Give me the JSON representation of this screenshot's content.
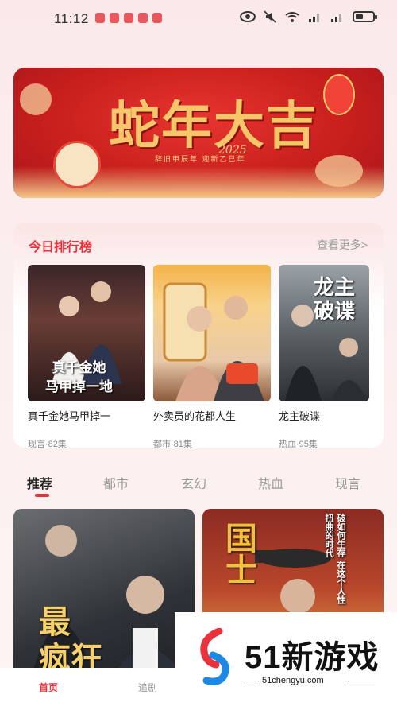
{
  "status_bar": {
    "time": "11:12"
  },
  "banner": {
    "title": "蛇年大吉",
    "year": "2025",
    "subtitle": "辞旧甲辰年 迎新乙巳年"
  },
  "ranking": {
    "title": "今日排行榜",
    "more_label": "查看更多>",
    "items": [
      {
        "name": "真千金她马甲掉一",
        "meta": "现言·82集",
        "cover_text": "真千金她\n马甲掉一地"
      },
      {
        "name": "外卖员的花都人生",
        "meta": "都市·81集",
        "cover_text": ""
      },
      {
        "name": "龙主破谍",
        "meta": "热血·95集",
        "cover_text": "龙主\n破谍"
      }
    ]
  },
  "tabs": [
    {
      "label": "推荐",
      "active": true
    },
    {
      "label": "都市",
      "active": false
    },
    {
      "label": "玄幻",
      "active": false
    },
    {
      "label": "热血",
      "active": false
    },
    {
      "label": "现言",
      "active": false
    }
  ],
  "feed": [
    {
      "cover_text": "最\n疯狂"
    },
    {
      "cover_text": "国士",
      "tagline": "破如何生存 在这个人性扭曲的时代"
    }
  ],
  "bottom_nav": {
    "home_label": "首页",
    "follow_label": "追剧"
  },
  "watermark": {
    "brand": "51新游戏",
    "url": "51chengyu.com"
  },
  "colors": {
    "accent": "#e8323c",
    "banner_red": "#c9201d",
    "gold": "#f6c76a"
  }
}
